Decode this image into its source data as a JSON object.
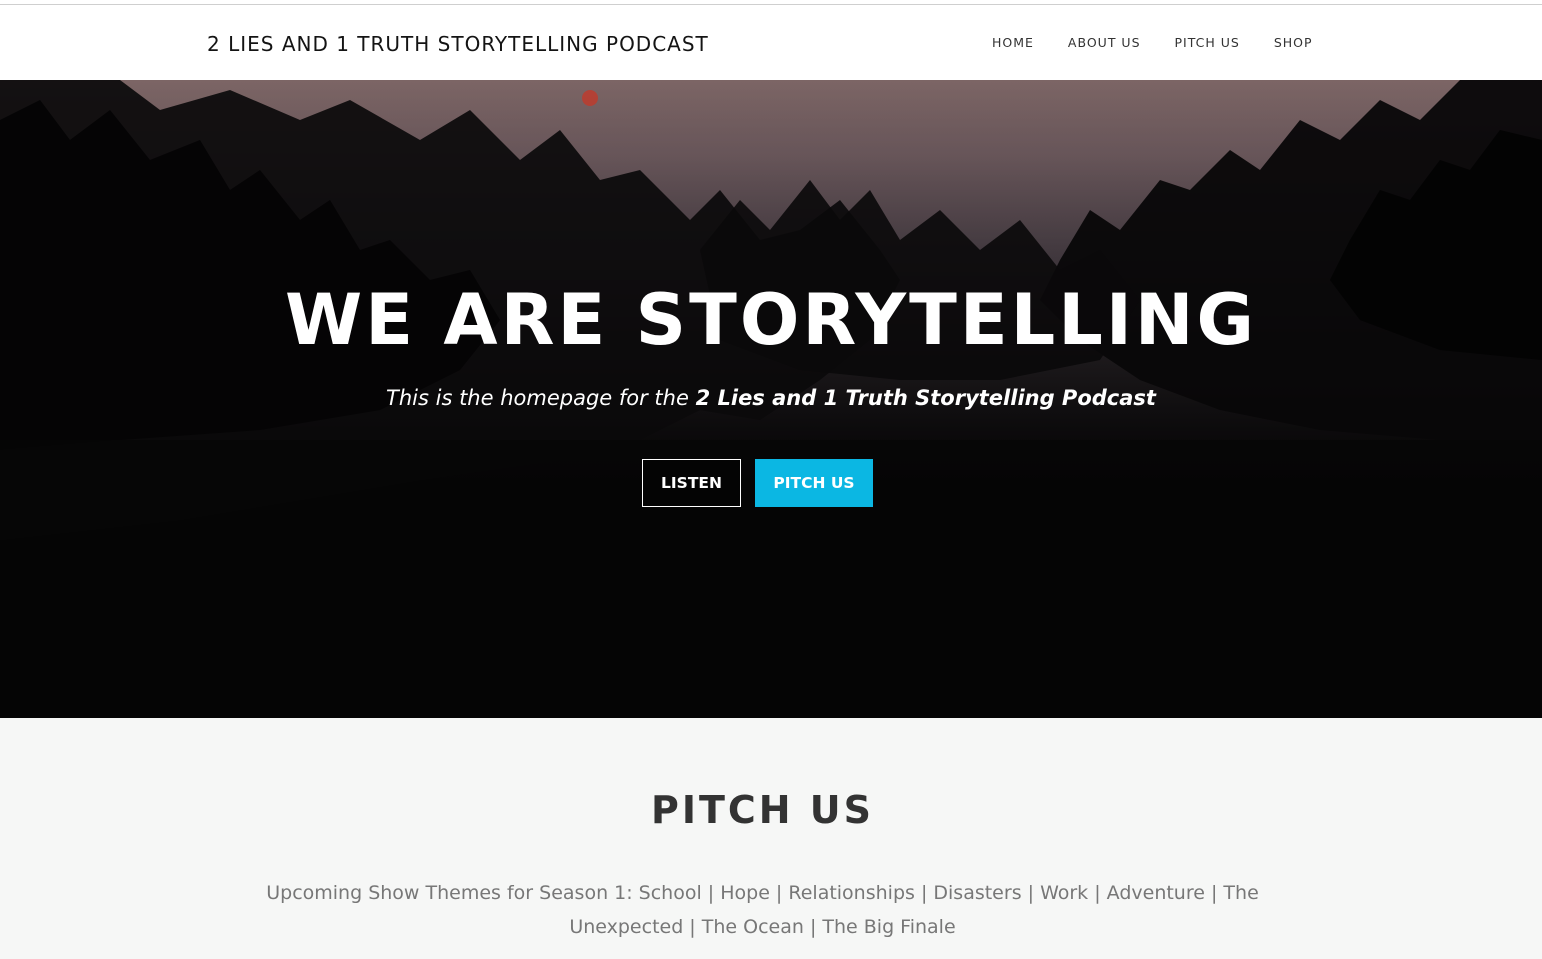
{
  "header": {
    "brand": "2 LIES AND 1 TRUTH STORYTELLING PODCAST",
    "nav": [
      "HOME",
      "ABOUT US",
      "PITCH US",
      "SHOP"
    ]
  },
  "hero": {
    "title": "WE ARE STORYTELLING",
    "subtitle_prefix": "This is the homepage for the ",
    "subtitle_bold": "2 Lies and 1 Truth Storytelling Podcast",
    "listen_label": "LISTEN",
    "pitch_label": "PITCH US"
  },
  "pitch_section": {
    "title": "PITCH US",
    "text": "Upcoming Show Themes for Season 1: School | Hope | Relationships | Disasters | Work | Adventure | The Unexpected | The Ocean | The Big Finale"
  },
  "colors": {
    "accent": "#0bb7e3",
    "nav_text": "#333333",
    "section_bg": "#f6f7f6",
    "section_text": "#777777"
  }
}
